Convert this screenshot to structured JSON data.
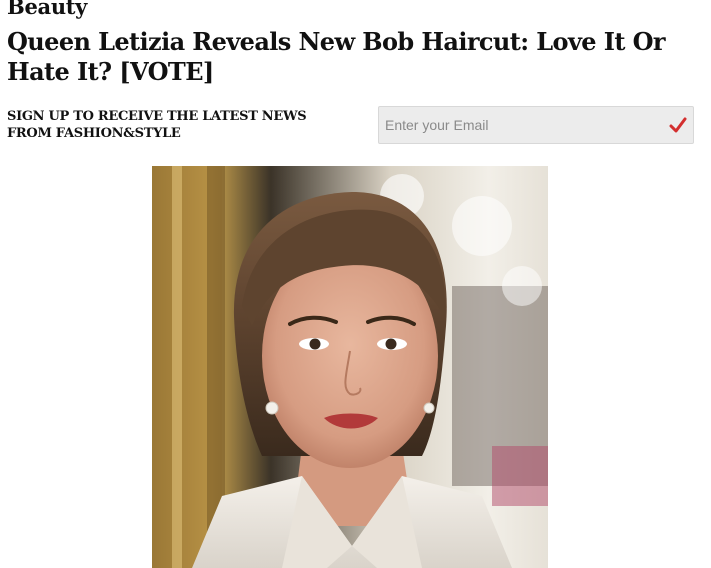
{
  "article": {
    "category": "Beauty",
    "headline": "Queen Letizia Reveals New Bob Haircut: Love It Or Hate It? [VOTE]"
  },
  "signup": {
    "text": "SIGN UP TO RECEIVE THE LATEST NEWS FROM FASHION&STYLE",
    "email_placeholder": "Enter your Email",
    "email_value": "",
    "submit_icon": "check-icon",
    "accent_color": "#d32f2f"
  },
  "photo": {
    "subject": "portrait-photo"
  }
}
